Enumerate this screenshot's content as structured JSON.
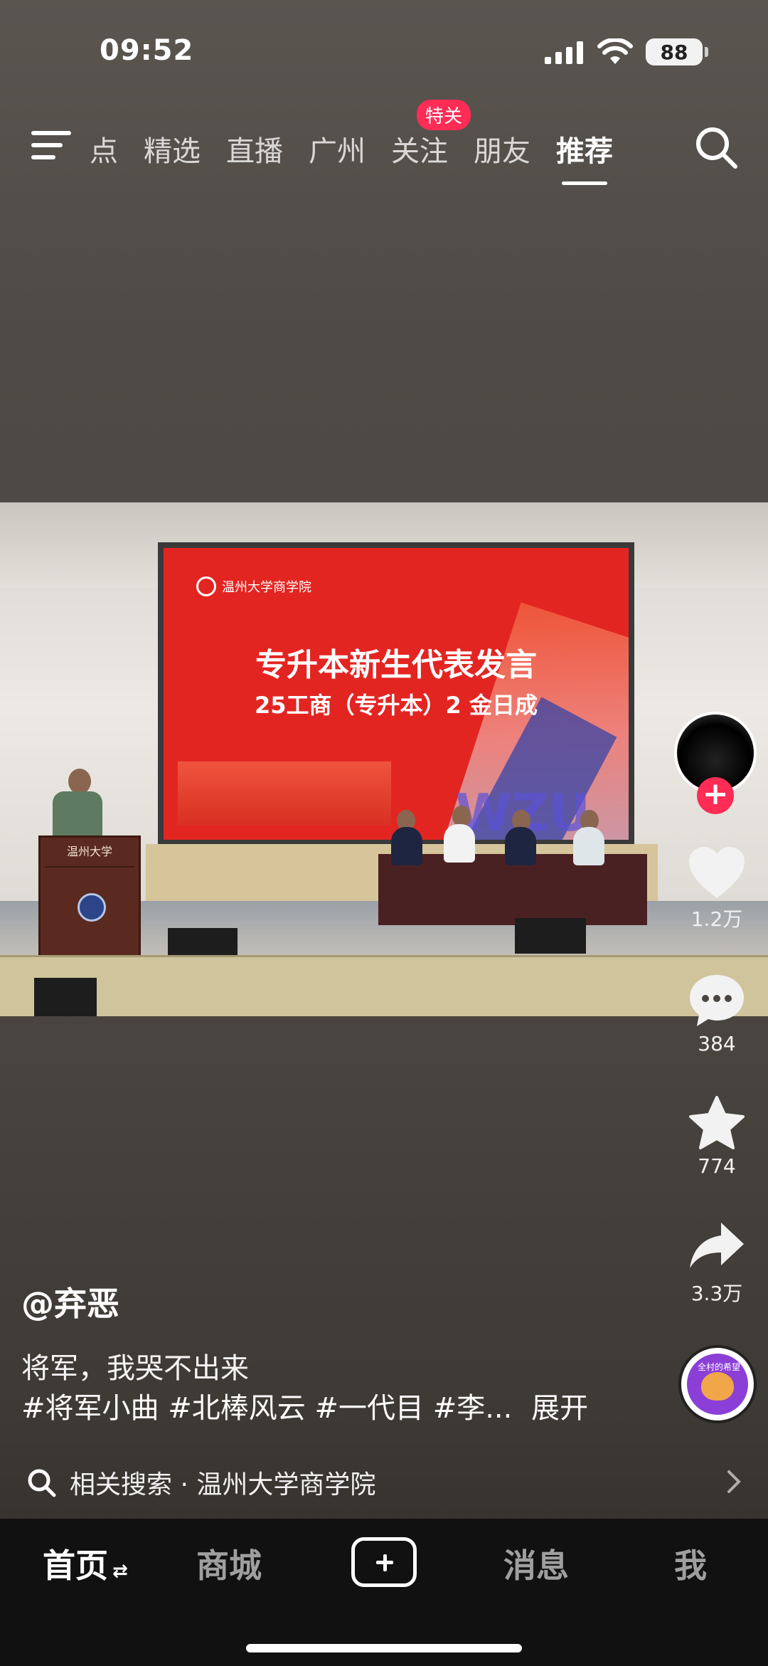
{
  "status_bar": {
    "time": "09:52",
    "battery": "88"
  },
  "top_nav": {
    "tabs": [
      {
        "label": "点",
        "partial": true
      },
      {
        "label": "精选"
      },
      {
        "label": "直播"
      },
      {
        "label": "广州"
      },
      {
        "label": "关注",
        "badge": "特关"
      },
      {
        "label": "朋友"
      },
      {
        "label": "推荐",
        "active": true
      }
    ]
  },
  "video": {
    "screen_logo": "温州大学商学院",
    "screen_title": "专升本新生代表发言",
    "screen_subtitle": "25工商（专升本）2 金日成",
    "screen_watermark": "WZU",
    "podium_sign": "温州大学"
  },
  "right_rail": {
    "like_count": "1.2万",
    "comment_count": "384",
    "favorite_count": "774",
    "share_count": "3.3万",
    "music_label": "全村的希望"
  },
  "post": {
    "author": "@弃恶",
    "caption": "将军，我哭不出来",
    "tags": "#将军小曲 #北棒风云 #一代目 #李...",
    "expand": "展开"
  },
  "related_search": {
    "text": "相关搜索 · 温州大学商学院"
  },
  "tab_bar": {
    "home": "首页",
    "home_swap": "⇄",
    "mall": "商城",
    "messages": "消息",
    "me": "我"
  },
  "colors": {
    "accent": "#ff2c55",
    "tab_bar_bg": "#111111"
  }
}
